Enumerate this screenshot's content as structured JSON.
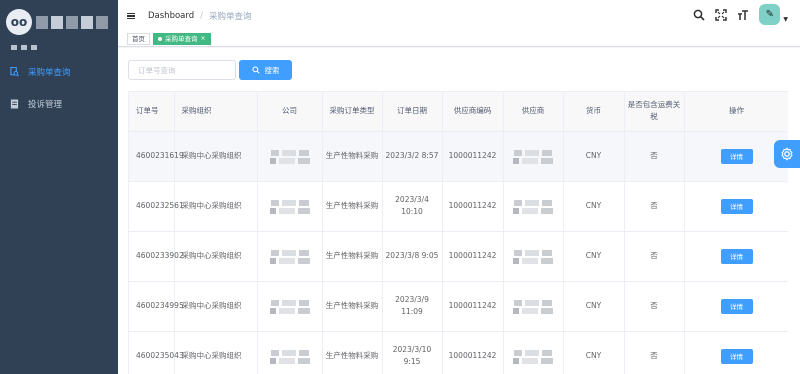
{
  "sidebar": {
    "logo_glyph": "oo",
    "items": [
      {
        "label": "采购单查询",
        "icon": "document-search-icon",
        "active": true
      },
      {
        "label": "投诉管理",
        "icon": "document-icon",
        "active": false
      }
    ]
  },
  "header": {
    "breadcrumb_home": "Dashboard",
    "breadcrumb_current": "采购单查询",
    "avatar_glyph": "✎"
  },
  "tags": {
    "home": "首页",
    "current": "采购单查询",
    "close": "×"
  },
  "search": {
    "placeholder": "订单号查询",
    "button_label": "搜索"
  },
  "table": {
    "headers": {
      "order_no": "订单号",
      "purchase_org": "采购组织",
      "company": "公司",
      "order_type": "采购订单类型",
      "order_date": "订单日期",
      "supplier_code": "供应商编码",
      "supplier": "供应商",
      "currency": "货币",
      "incl_fee": "是否包含运费关税",
      "actions": "操作"
    },
    "rows": [
      {
        "order_no": "4600231619",
        "org": "采购中心采购组织",
        "type": "生产性物料采购",
        "date": "2023/3/2 8:57",
        "supplier_code": "1000011242",
        "currency": "CNY",
        "incl": "否",
        "action": "详情"
      },
      {
        "order_no": "4600232561",
        "org": "采购中心采购组织",
        "type": "生产性物料采购",
        "date": "2023/3/4 10:10",
        "supplier_code": "1000011242",
        "currency": "CNY",
        "incl": "否",
        "action": "详情"
      },
      {
        "order_no": "4600233902",
        "org": "采购中心采购组织",
        "type": "生产性物料采购",
        "date": "2023/3/8 9:05",
        "supplier_code": "1000011242",
        "currency": "CNY",
        "incl": "否",
        "action": "详情"
      },
      {
        "order_no": "4600234995",
        "org": "采购中心采购组织",
        "type": "生产性物料采购",
        "date": "2023/3/9 11:09",
        "supplier_code": "1000011242",
        "currency": "CNY",
        "incl": "否",
        "action": "详情"
      },
      {
        "order_no": "4600235043",
        "org": "采购中心采购组织",
        "type": "生产性物料采购",
        "date": "2023/3/10 9:15",
        "supplier_code": "1000011242",
        "currency": "CNY",
        "incl": "否",
        "action": "详情"
      }
    ]
  },
  "colors": {
    "sidebar_bg": "#304156",
    "primary": "#409eff",
    "tag_active": "#42b983"
  }
}
